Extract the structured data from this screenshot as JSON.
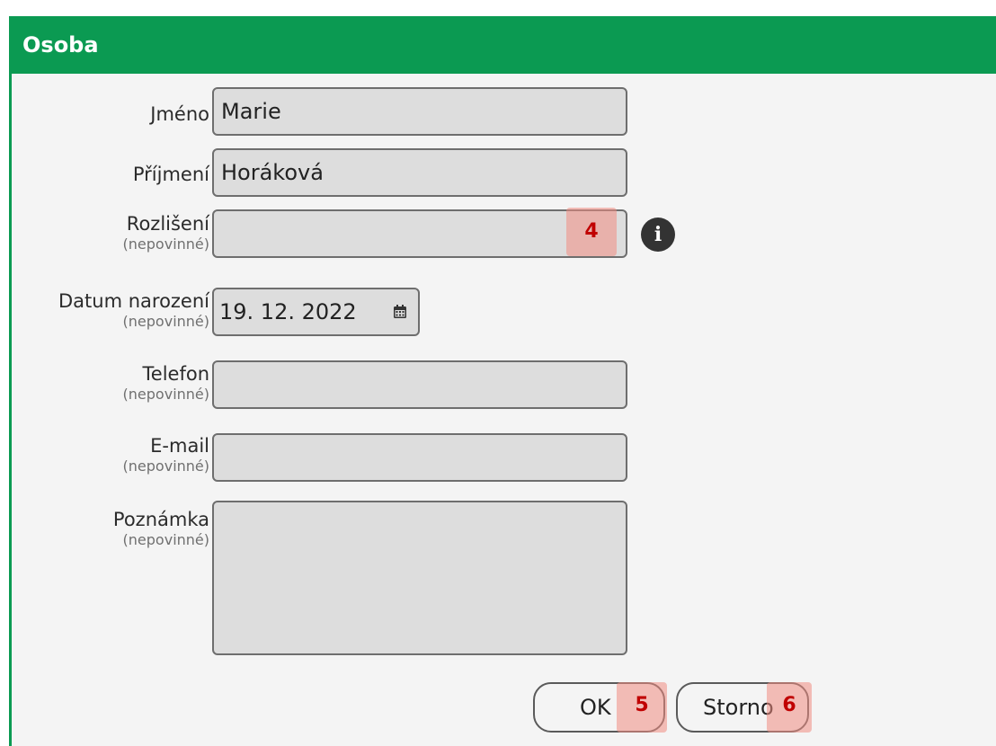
{
  "dialog": {
    "title": "Osoba"
  },
  "fields": {
    "jmeno": {
      "label": "Jméno",
      "value": "Marie"
    },
    "prijmeni": {
      "label": "Příjmení",
      "value": "Horáková"
    },
    "rozliseni": {
      "label": "Rozlišení",
      "sub": "(nepovinné)",
      "value": ""
    },
    "datum": {
      "label": "Datum narození",
      "sub": "(nepovinné)",
      "value": "19. 12. 2022"
    },
    "telefon": {
      "label": "Telefon",
      "sub": "(nepovinné)",
      "value": ""
    },
    "email": {
      "label": "E-mail",
      "sub": "(nepovinné)",
      "value": ""
    },
    "poznamka": {
      "label": "Poznámka",
      "sub": "(nepovinné)",
      "value": ""
    }
  },
  "icons": {
    "info": "info-icon",
    "calendar": "calendar-icon"
  },
  "buttons": {
    "ok": "OK",
    "storno": "Storno"
  },
  "badges": {
    "b4": "4",
    "b5": "5",
    "b6": "6"
  },
  "colors": {
    "accent": "#0b9a52",
    "badge": "#c00000"
  }
}
